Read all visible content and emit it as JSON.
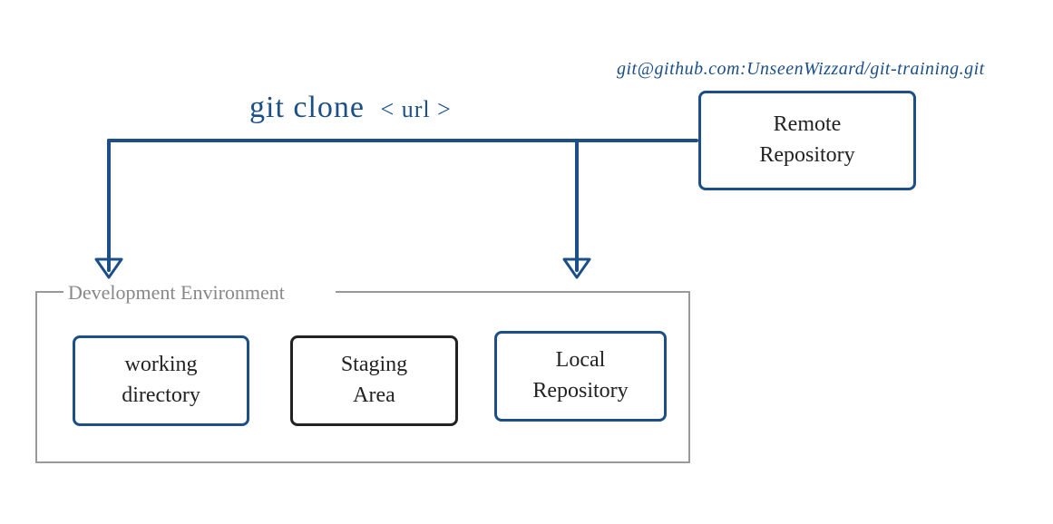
{
  "command": {
    "text": "git clone",
    "arg": "< url >"
  },
  "url": "git@github.com:UnseenWizzard/git-training.git",
  "remote": {
    "line1": "Remote",
    "line2": "Repository"
  },
  "env": {
    "label": "Development Environment",
    "working": {
      "line1": "working",
      "line2": "directory"
    },
    "staging": {
      "line1": "Staging",
      "line2": "Area"
    },
    "local": {
      "line1": "Local",
      "line2": "Repository"
    }
  },
  "colors": {
    "blue": "#1c4f87",
    "gray": "#888888",
    "black": "#222222"
  }
}
